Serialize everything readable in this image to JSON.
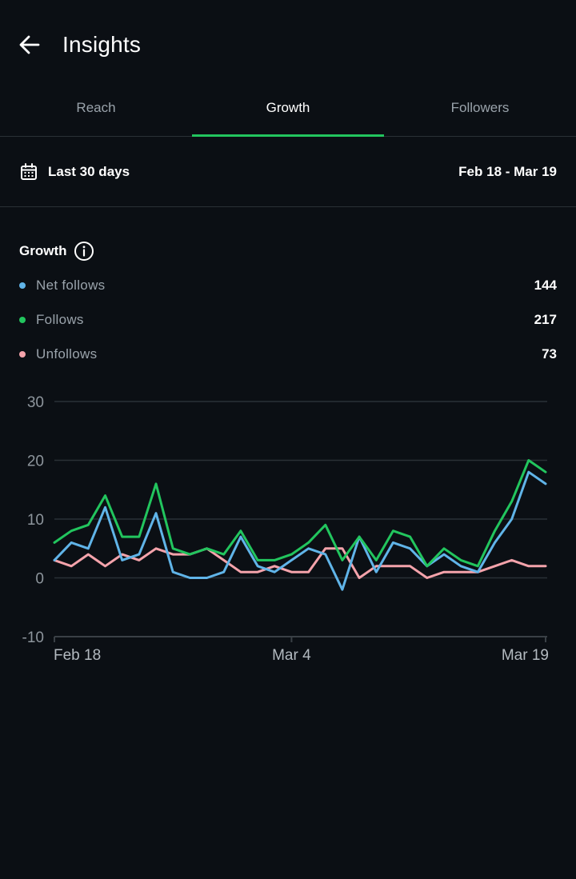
{
  "header": {
    "title": "Insights"
  },
  "tabs": [
    {
      "label": "Reach",
      "active": false
    },
    {
      "label": "Growth",
      "active": true
    },
    {
      "label": "Followers",
      "active": false
    }
  ],
  "range": {
    "label": "Last 30 days",
    "dates": "Feb 18 - Mar 19"
  },
  "section": {
    "title": "Growth"
  },
  "legend": [
    {
      "name": "Net follows",
      "value": "144",
      "color": "#60b4e8"
    },
    {
      "name": "Follows",
      "value": "217",
      "color": "#22c55e"
    },
    {
      "name": "Unfollows",
      "value": "73",
      "color": "#f4a3ab"
    }
  ],
  "colors": {
    "accent": "#22c55e",
    "background": "#0b0f14",
    "grid": "#2a3036",
    "muted": "#9aa3ab"
  },
  "chart_data": {
    "type": "line",
    "x_tick_labels": [
      "Feb 18",
      "Mar 4",
      "Mar 19"
    ],
    "x_tick_index": [
      0,
      14,
      29
    ],
    "ylim": [
      -10,
      30
    ],
    "y_ticks": [
      -10,
      0,
      10,
      20,
      30
    ],
    "grid": true,
    "series": [
      {
        "name": "Net follows",
        "color": "#60b4e8",
        "values": [
          3,
          6,
          5,
          12,
          3,
          4,
          11,
          1,
          0,
          0,
          1,
          7,
          2,
          1,
          3,
          5,
          4,
          -2,
          7,
          1,
          6,
          5,
          2,
          4,
          2,
          1,
          6,
          10,
          18,
          16
        ]
      },
      {
        "name": "Follows",
        "color": "#22c55e",
        "values": [
          6,
          8,
          9,
          14,
          7,
          7,
          16,
          5,
          4,
          5,
          4,
          8,
          3,
          3,
          4,
          6,
          9,
          3,
          7,
          3,
          8,
          7,
          2,
          5,
          3,
          2,
          8,
          13,
          20,
          18
        ]
      },
      {
        "name": "Unfollows",
        "color": "#f4a3ab",
        "values": [
          3,
          2,
          4,
          2,
          4,
          3,
          5,
          4,
          4,
          5,
          3,
          1,
          1,
          2,
          1,
          1,
          5,
          5,
          0,
          2,
          2,
          2,
          0,
          1,
          1,
          1,
          2,
          3,
          2,
          2
        ]
      }
    ]
  }
}
